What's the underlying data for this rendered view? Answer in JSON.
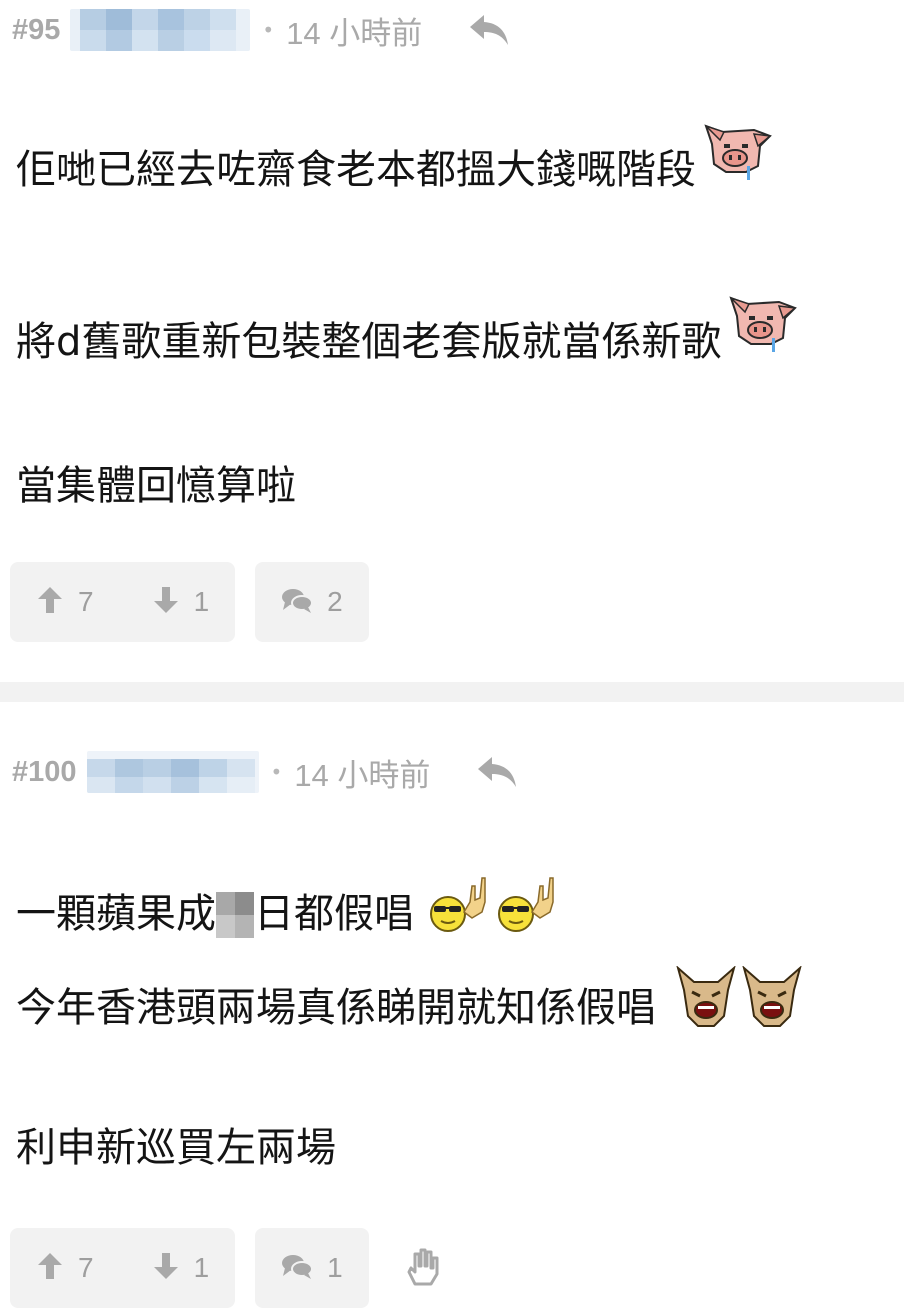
{
  "posts": [
    {
      "floor": "#95",
      "dot": "•",
      "time": "14 小時前",
      "lines": [
        "佢哋已經去咗齋食老本都搵大錢嘅階段",
        "將d舊歌重新包裝整個老套版就當係新歌",
        "當集體回憶算啦"
      ],
      "emoticons": [
        "pig-crying-icon",
        "pig-crying-icon"
      ],
      "upvotes": "7",
      "downvotes": "1",
      "comments": "2"
    },
    {
      "floor": "#100",
      "dot": "•",
      "time": "14 小時前",
      "line1_prefix": "一顆蘋果成",
      "line1_suffix": "日都假唱",
      "line2": "今年香港頭兩場真係睇開就知係假唱",
      "line3": "利申新巡買左兩場",
      "emoticons": [
        "sunglasses-rock-icon",
        "sunglasses-rock-icon",
        "shocked-horse-icon",
        "shocked-horse-icon"
      ],
      "upvotes": "7",
      "downvotes": "1",
      "comments": "1"
    }
  ],
  "colors": {
    "meta_text": "#a9a9a9",
    "body_text": "#141414",
    "pill_bg": "#f2f2f2",
    "divider": "#f2f2f2",
    "username_blur": "#b9cfe4"
  }
}
